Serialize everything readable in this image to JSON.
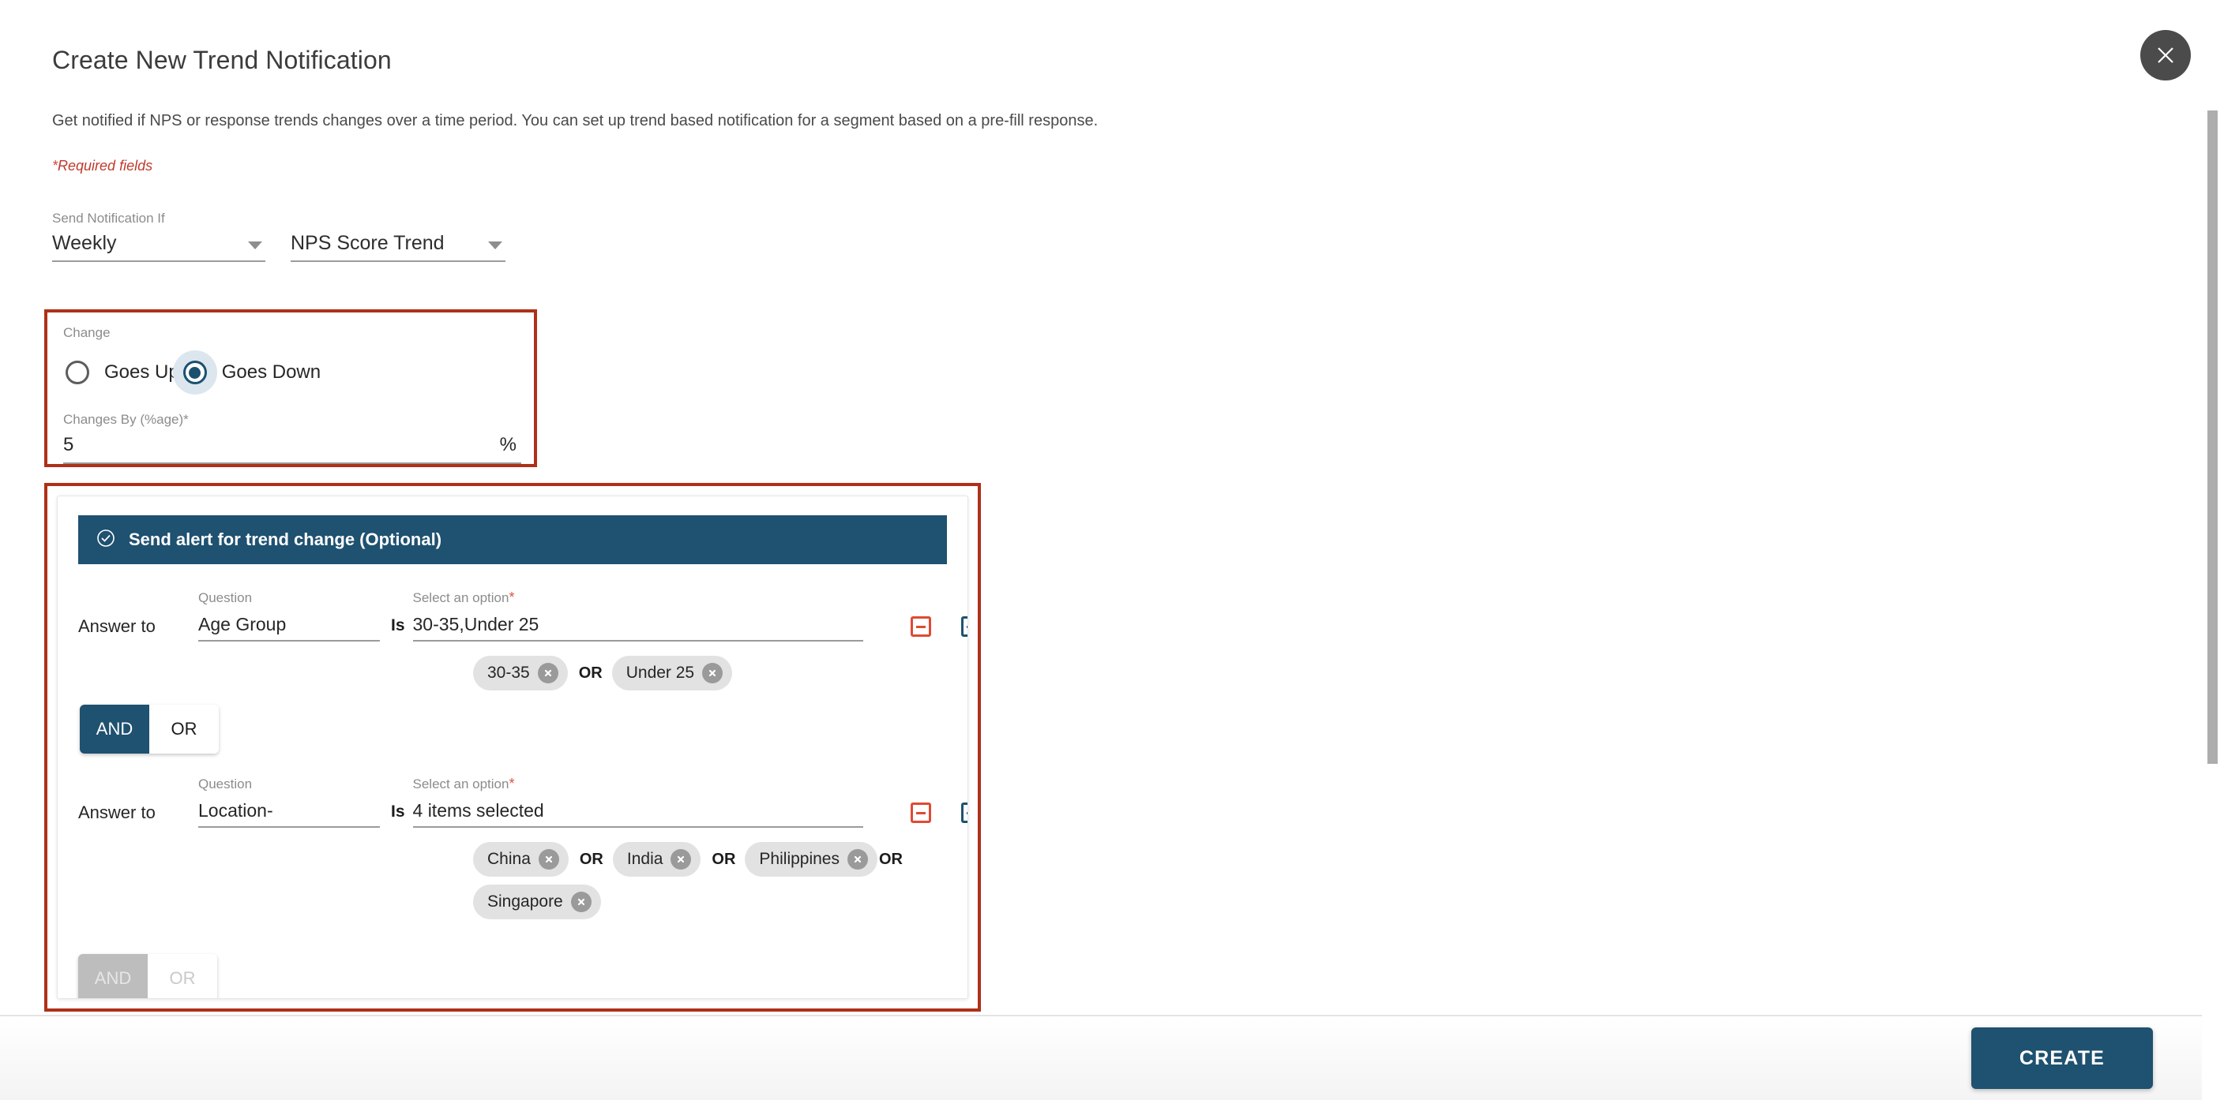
{
  "header": {
    "title": "Create New Trend Notification",
    "subtitle": "Get notified if NPS or response trends changes over a time period. You can set up trend based notification for a segment based on a pre-fill response.",
    "required_note": "Required fields",
    "required_star": "*",
    "close_icon": "close-icon"
  },
  "send_notification": {
    "label": "Send Notification If",
    "frequency_value": "Weekly",
    "metric_value": "NPS Score Trend"
  },
  "change": {
    "label": "Change",
    "options": [
      {
        "label": "Goes Up",
        "selected": false
      },
      {
        "label": "Goes Down",
        "selected": true
      }
    ],
    "changes_by_label": "Changes By (%age)*",
    "changes_by_value": "5",
    "unit": "%"
  },
  "alert": {
    "header_label": "Send alert for trend change (Optional)",
    "header_icon": "check-circle-icon",
    "conditions": [
      {
        "answer_to_label": "Answer to",
        "question_label": "Question",
        "question_value": "Age Group",
        "is_label": "Is",
        "option_label": "Select an option",
        "option_required_star": "*",
        "option_value": "30-35,Under 25",
        "remove_icon": "minus-box-icon",
        "add_icon": "plus-box-icon",
        "chips": [
          "30-35",
          "Under 25"
        ],
        "chip_separator": "OR"
      },
      {
        "answer_to_label": "Answer to",
        "question_label": "Question",
        "question_value": "Location-",
        "is_label": "Is",
        "option_label": "Select an option",
        "option_required_star": "*",
        "option_value": "4 items selected",
        "remove_icon": "minus-box-icon",
        "add_icon": "plus-box-icon",
        "chips": [
          "China",
          "India",
          "Philippines",
          "Singapore"
        ],
        "chip_separator": "OR"
      }
    ],
    "toggles": [
      {
        "and_label": "AND",
        "or_label": "OR",
        "selected": "AND",
        "disabled": false
      },
      {
        "and_label": "AND",
        "or_label": "OR",
        "selected": "AND",
        "disabled": true
      }
    ]
  },
  "footer": {
    "create_label": "CREATE"
  },
  "colors": {
    "accent_blue": "#1f5170",
    "highlight_red": "#ae3018",
    "remove_red": "#e04a33",
    "chip_gray": "#e2e2e2"
  }
}
